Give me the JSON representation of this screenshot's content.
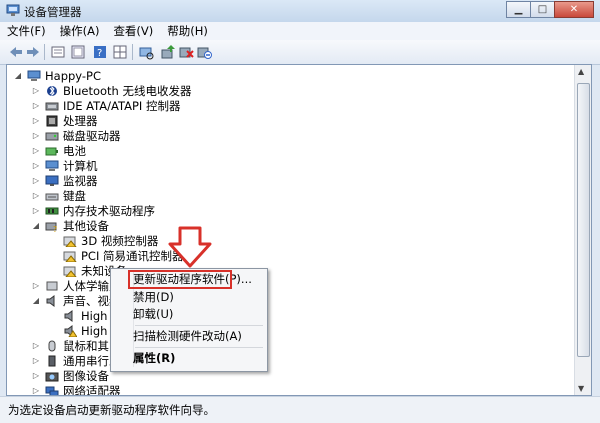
{
  "window": {
    "title": "设备管理器",
    "title_icon": "device-manager-icon"
  },
  "menu": [
    "文件(F)",
    "操作(A)",
    "查看(V)",
    "帮助(H)"
  ],
  "toolbar_icons": [
    "back-icon",
    "forward-icon",
    "properties-icon",
    "show-hide-icon",
    "help-icon",
    "grid-icon",
    "scan-hardware-icon",
    "update-driver-icon",
    "uninstall-icon",
    "disable-icon"
  ],
  "tree": {
    "root": "Happy-PC",
    "items": [
      {
        "label": "Bluetooth 无线电收发器",
        "icon": "bluetooth-icon"
      },
      {
        "label": "IDE ATA/ATAPI 控制器",
        "icon": "ide-controller-icon"
      },
      {
        "label": "处理器",
        "icon": "processor-icon"
      },
      {
        "label": "磁盘驱动器",
        "icon": "disk-drive-icon"
      },
      {
        "label": "电池",
        "icon": "battery-icon"
      },
      {
        "label": "计算机",
        "icon": "computer-icon"
      },
      {
        "label": "监视器",
        "icon": "monitor-icon"
      },
      {
        "label": "键盘",
        "icon": "keyboard-icon"
      },
      {
        "label": "内存技术驱动程序",
        "icon": "memory-icon"
      },
      {
        "label": "其他设备",
        "icon": "other-devices-icon"
      },
      {
        "label": "3D 视频控制器",
        "icon": "warning-device-icon"
      },
      {
        "label": "PCI 简易通讯控制器",
        "icon": "warning-device-icon"
      },
      {
        "label": "未知设备",
        "icon": "warning-device-icon"
      },
      {
        "label": "人体学输入设",
        "icon": "hid-icon"
      },
      {
        "label": "声音、视频和",
        "icon": "sound-icon"
      },
      {
        "label": "High De",
        "icon": "speaker-icon"
      },
      {
        "label": "High De",
        "icon": "speaker-warning-icon"
      },
      {
        "label": "鼠标和其它指",
        "icon": "mouse-icon"
      },
      {
        "label": "通用串行总线",
        "icon": "usb-icon"
      },
      {
        "label": "图像设备",
        "icon": "imaging-icon"
      },
      {
        "label": "网络适配器",
        "icon": "network-icon"
      }
    ]
  },
  "context_menu": {
    "items": [
      {
        "label": "更新驱动程序软件(P)...",
        "bold": false
      },
      {
        "label": "禁用(D)",
        "bold": false
      },
      {
        "label": "卸载(U)",
        "bold": false
      },
      {
        "label": "扫描检测硬件改动(A)",
        "bold": false
      },
      {
        "label": "属性(R)",
        "bold": true
      }
    ],
    "highlight_color": "#d8312a"
  },
  "annotation_arrow_color": "#d8312a",
  "status": "为选定设备启动更新驱动程序软件向导。"
}
